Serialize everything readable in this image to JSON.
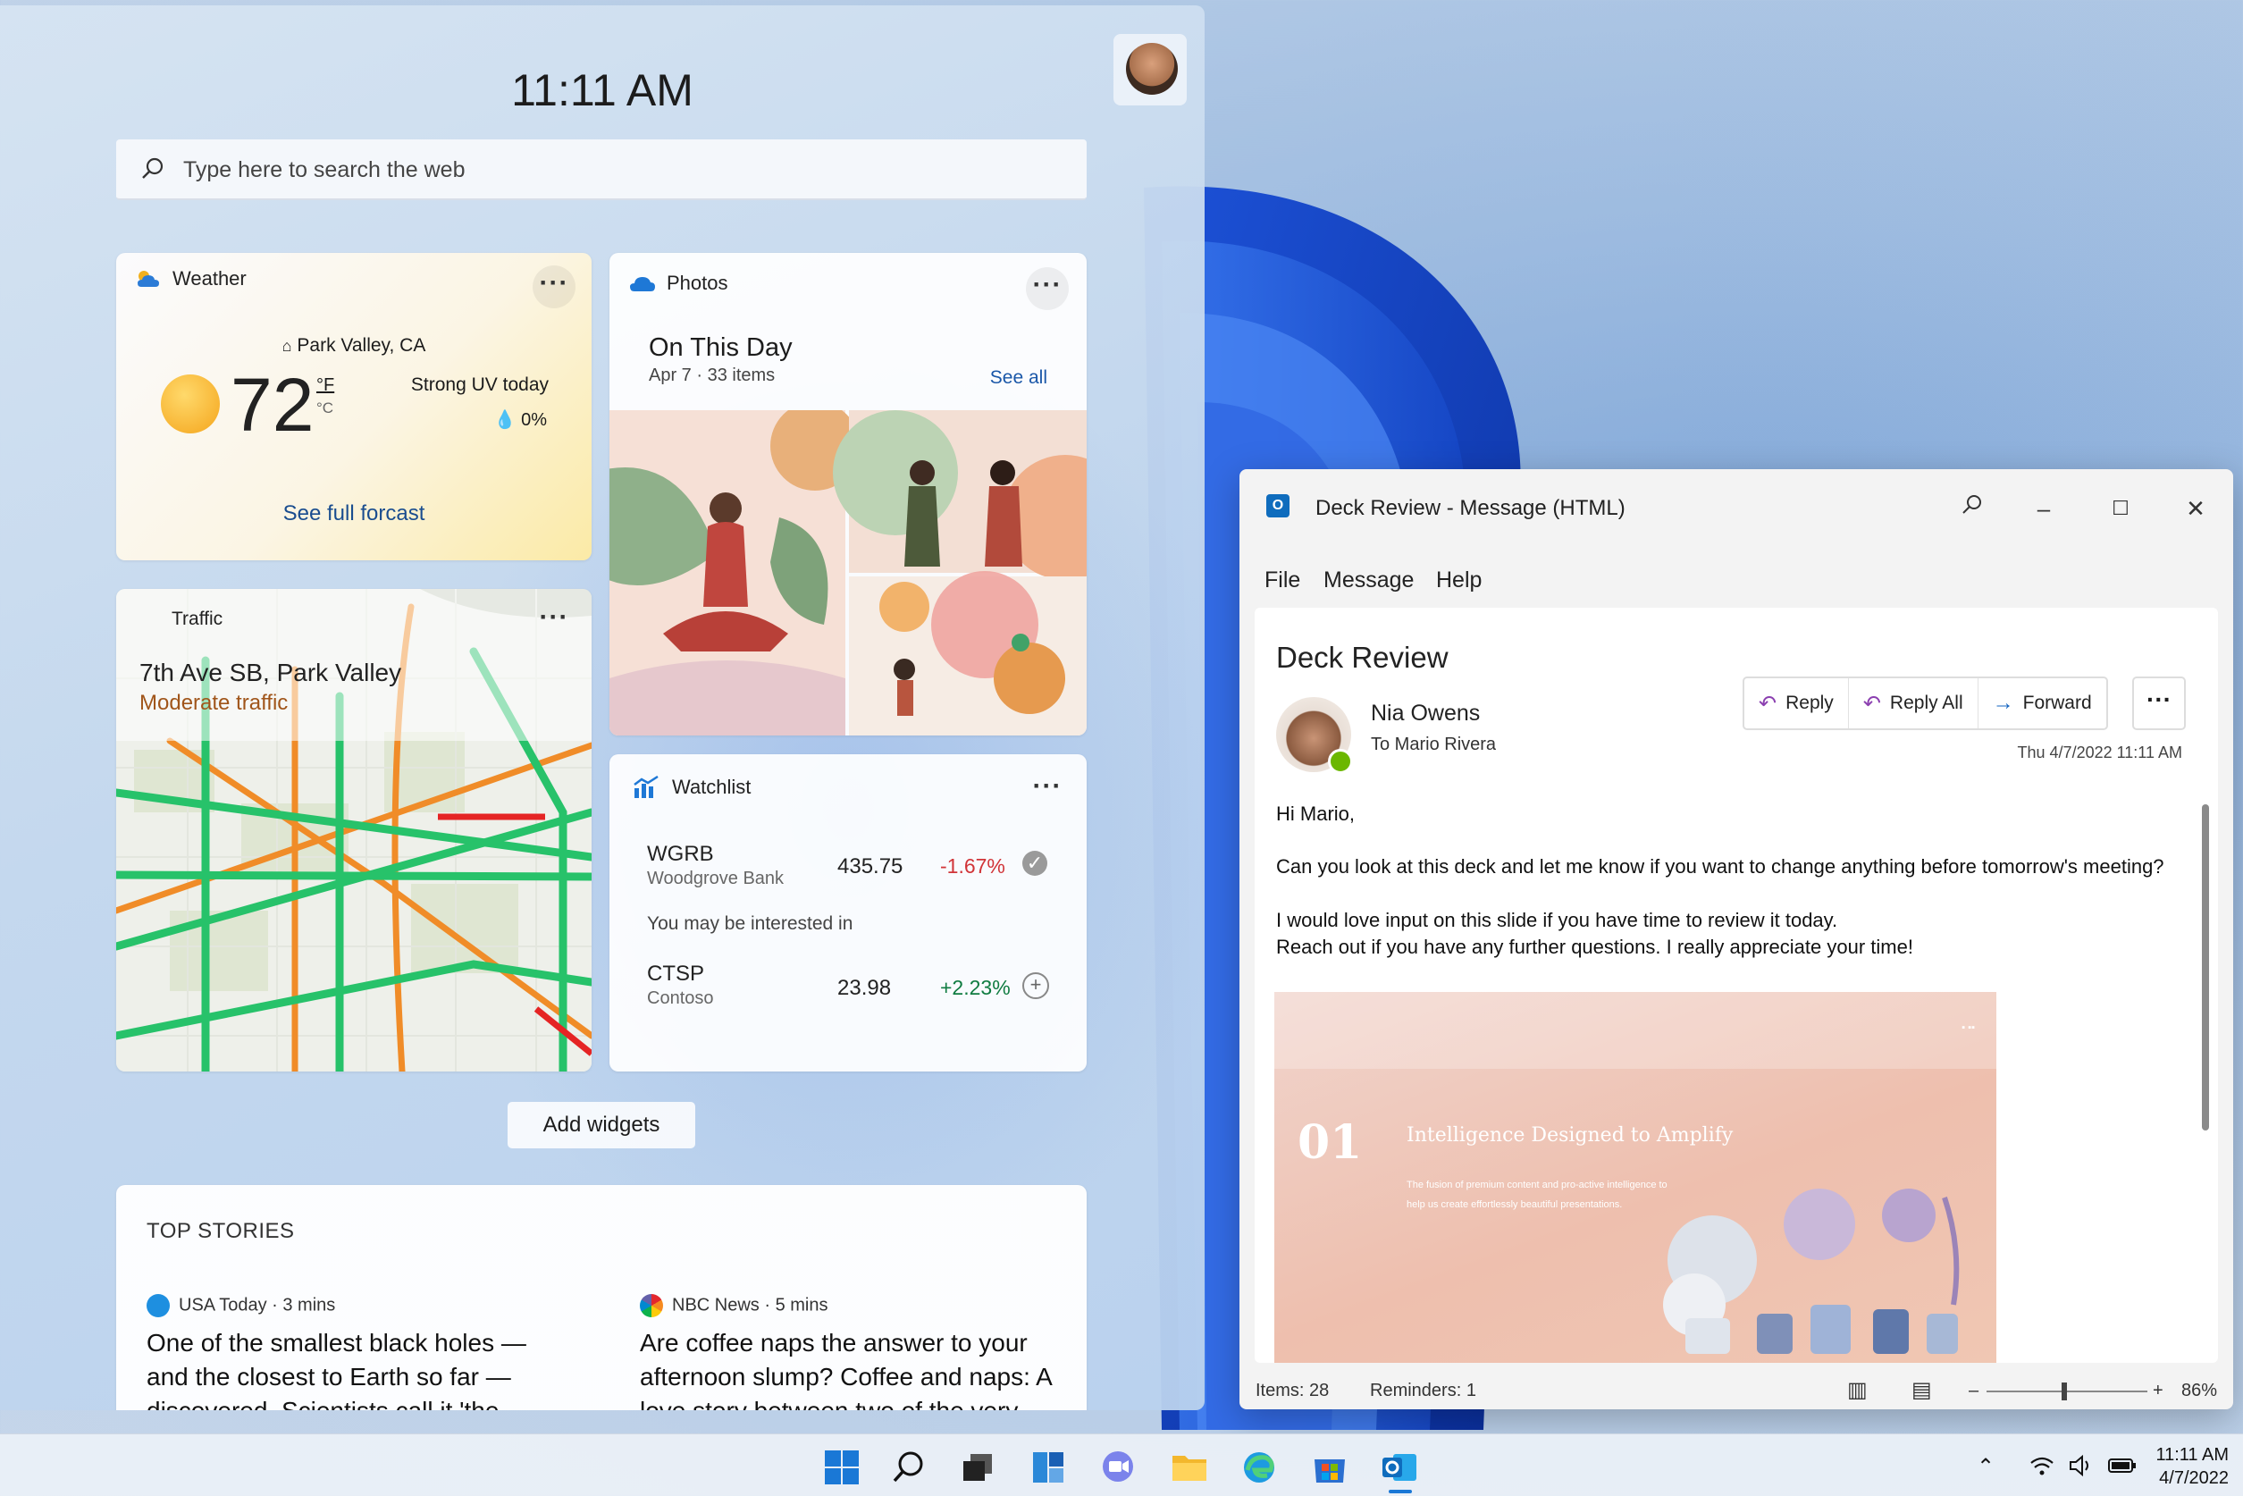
{
  "widgets": {
    "clock": "11:11 AM",
    "search_placeholder": "Type here to search the web",
    "weather": {
      "title": "Weather",
      "location": "Park Valley, CA",
      "temp": "72",
      "unit_f": "°F",
      "unit_c": "°C",
      "condition": "Strong UV today",
      "precip": "0%",
      "link": "See full forcast"
    },
    "traffic": {
      "title": "Traffic",
      "street": "7th Ave SB, Park Valley",
      "status": "Moderate traffic"
    },
    "photos": {
      "title": "Photos",
      "heading": "On This Day",
      "subtitle": "Apr 7 · 33 items",
      "see_all": "See all"
    },
    "watchlist": {
      "title": "Watchlist",
      "interested": "You may be interested in",
      "items": [
        {
          "symbol": "WGRB",
          "name": "Woodgrove Bank",
          "price": "435.75",
          "change": "-1.67%"
        },
        {
          "symbol": "CTSP",
          "name": "Contoso",
          "price": "23.98",
          "change": "+2.23%"
        }
      ]
    },
    "add_widgets": "Add widgets",
    "top_stories": {
      "heading": "TOP STORIES",
      "stories": [
        {
          "source": "USA Today · 3 mins",
          "title": "One of the smallest black holes — and the closest to Earth so far — discovered. Scientists call it 'the"
        },
        {
          "source": "NBC News · 5 mins",
          "title": "Are coffee naps the answer to your afternoon slump? Coffee and naps: A love story between two of the very"
        }
      ]
    }
  },
  "outlook": {
    "window_title": "Deck Review  -  Message (HTML)",
    "menu": [
      "File",
      "Message",
      "Help"
    ],
    "subject": "Deck Review",
    "sender": "Nia Owens",
    "to": "To  Mario Rivera",
    "date": "Thu 4/7/2022 11:11 AM",
    "actions": {
      "reply": "Reply",
      "reply_all": "Reply All",
      "forward": "Forward"
    },
    "body": [
      "Hi Mario,",
      "Can you look at this deck and let me know if you want to change anything before tomorrow's meeting?",
      "I would love input on this slide if you have time to review it today.",
      "Reach out if you have any further questions. I really appreciate your time!"
    ],
    "slide": {
      "number": "01",
      "title": "Intelligence Designed to Amplify",
      "subtitle": "The fusion of premium content and pro-active intelligence to help us create effortlessly beautiful presentations."
    },
    "status": {
      "items": "Items: 28",
      "reminders": "Reminders: 1",
      "zoom": "86%"
    }
  },
  "taskbar": {
    "time": "11:11 AM",
    "date": "4/7/2022"
  }
}
